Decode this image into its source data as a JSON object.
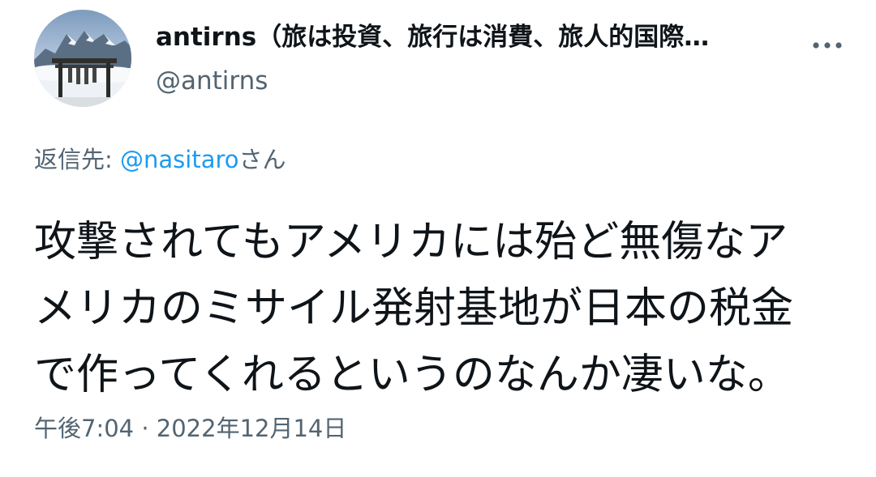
{
  "tweet": {
    "author": {
      "display_name": "antirns（旅は投資、旅行は消費、旅人的国際…",
      "handle": "@antirns"
    },
    "reply_to": {
      "prefix": "返信先: ",
      "mention": "@nasitaro",
      "suffix": "さん"
    },
    "body_lines": [
      "攻撃されてもアメリカには殆ど無傷なア",
      "メリカのミサイル発射基地が日本の税金",
      "で作ってくれるというのなんか凄いな。"
    ],
    "timestamp": {
      "time": "午後7:04",
      "separator": " · ",
      "date": "2022年12月14日"
    }
  },
  "icons": {
    "more": "more-horizontal-icon",
    "avatar": "mountain-torii-avatar"
  },
  "colors": {
    "text_primary": "#0f1419",
    "text_secondary": "#536471",
    "link": "#1d9bf0",
    "background": "#ffffff"
  }
}
